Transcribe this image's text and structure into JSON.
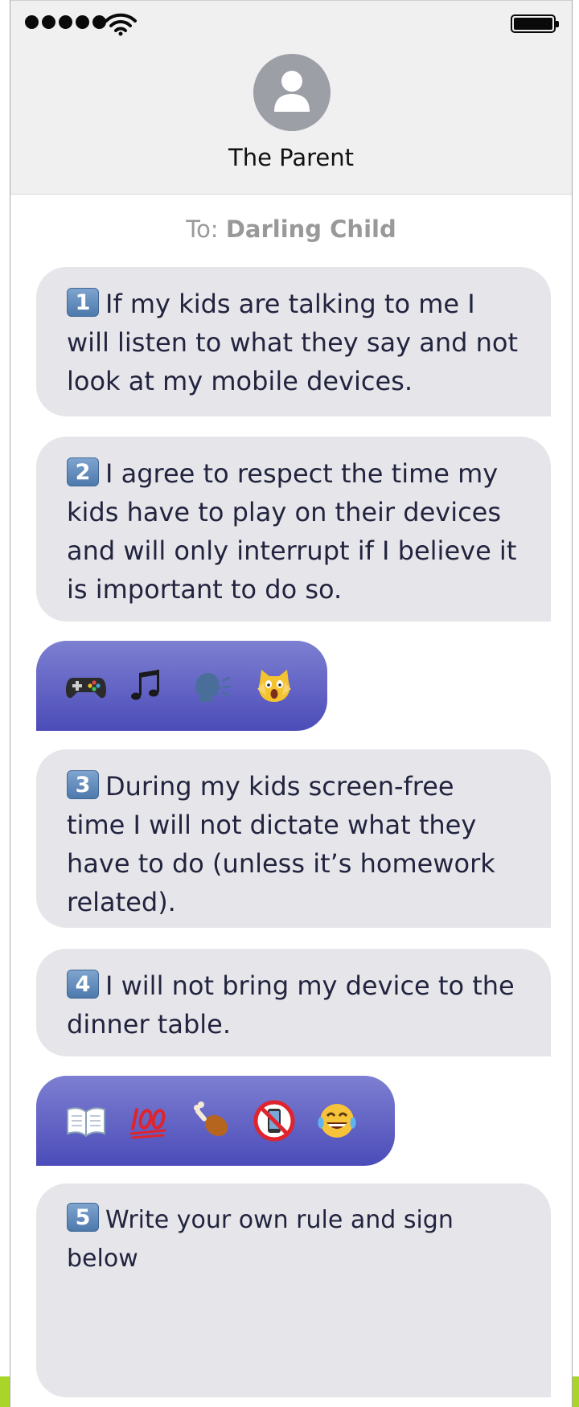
{
  "status_bar": {
    "signal_icon": "signal-dots-icon",
    "wifi_icon": "wifi-icon",
    "battery_icon": "battery-icon",
    "battery_level": 1.0
  },
  "header": {
    "avatar_icon": "person-silhouette-icon",
    "contact_name": "The Parent"
  },
  "recipient": {
    "prefix": "To:",
    "name": "Darling Child"
  },
  "messages": [
    {
      "number": "1",
      "text": "If my kids are talking to me I will listen to what they say and not look at my mobile devices."
    },
    {
      "number": "2",
      "text": "I agree to respect the time my kids have to play on their devices and will only interrupt if I believe it is important to do so."
    },
    {
      "emojis": [
        "game-controller-icon",
        "music-notes-icon",
        "speaking-head-icon",
        "screaming-cat-icon"
      ]
    },
    {
      "number": "3",
      "text": "During my kids screen-free time I will not dictate what they have to do (unless it’s homework related)."
    },
    {
      "number": "4",
      "text": "I will not bring my device to the dinner table."
    },
    {
      "emojis": [
        "open-book-icon",
        "hundred-points-icon",
        "poultry-leg-icon",
        "no-mobile-phones-icon",
        "tears-of-joy-icon"
      ]
    },
    {
      "number": "5",
      "text": "Write your own rule and sign below"
    }
  ],
  "colors": {
    "received_bubble": "#e6e6ea",
    "sent_bubble_top": "#7d7fd1",
    "sent_bubble_bottom": "#4c4cb9",
    "header_bg": "#f0f0f0",
    "accent_green": "#a8d528"
  }
}
